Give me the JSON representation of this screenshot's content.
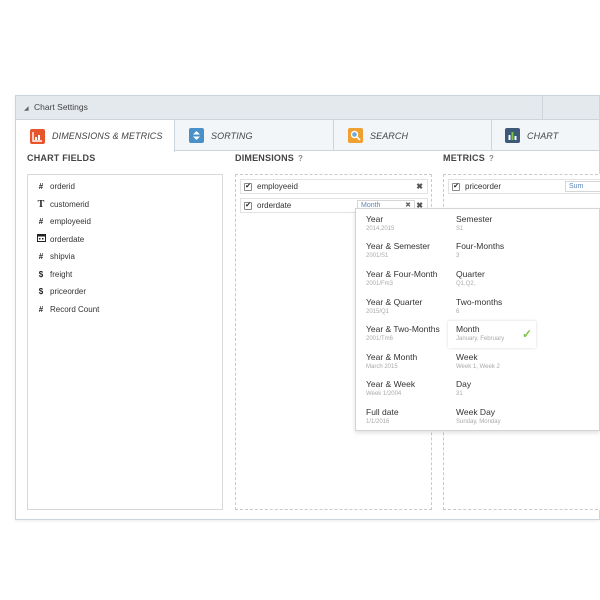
{
  "header": {
    "title": "Chart Settings"
  },
  "tabs": [
    {
      "label": "DIMENSIONS & METRICS",
      "icon": "dimensions-metrics-icon",
      "color": "#e8542c"
    },
    {
      "label": "SORTING",
      "icon": "sort-icon",
      "color": "#4a90c8"
    },
    {
      "label": "SEARCH",
      "icon": "search-icon",
      "color": "#f0a030"
    },
    {
      "label": "CHART",
      "icon": "bar-chart-icon",
      "color": "#3c5a78"
    }
  ],
  "chart_fields": {
    "title": "CHART FIELDS",
    "items": [
      {
        "icon": "#",
        "label": "orderid"
      },
      {
        "icon": "T",
        "label": "customerid"
      },
      {
        "icon": "#",
        "label": "employeeid"
      },
      {
        "icon": "cal",
        "label": "orderdate"
      },
      {
        "icon": "#",
        "label": "shipvia"
      },
      {
        "icon": "$",
        "label": "freight"
      },
      {
        "icon": "$",
        "label": "priceorder"
      },
      {
        "icon": "#",
        "label": "Record Count"
      }
    ]
  },
  "dimensions": {
    "title": "DIMENSIONS",
    "help": "?",
    "items": [
      {
        "label": "employeeid",
        "remove": "✖"
      },
      {
        "label": "orderdate",
        "select": "Month",
        "select_remove": "✖",
        "remove": "✖"
      }
    ]
  },
  "metrics": {
    "title": "METRICS",
    "help": "?",
    "items": [
      {
        "label": "priceorder",
        "select": "Sum"
      }
    ]
  },
  "date_dropdown": {
    "left": [
      {
        "label": "Year",
        "sample": "2014,2015"
      },
      {
        "label": "Year & Semester",
        "sample": "2001/S1"
      },
      {
        "label": "Year & Four-Month",
        "sample": "2001/Fm3"
      },
      {
        "label": "Year & Quarter",
        "sample": "2015/Q1"
      },
      {
        "label": "Year & Two-Months",
        "sample": "2001/Tm6"
      },
      {
        "label": "Year & Month",
        "sample": "March 2015"
      },
      {
        "label": "Year & Week",
        "sample": "Week 1/2004"
      },
      {
        "label": "Full date",
        "sample": "1/1/2016"
      }
    ],
    "right": [
      {
        "label": "Semester",
        "sample": "S1"
      },
      {
        "label": "Four-Months",
        "sample": "3"
      },
      {
        "label": "Quarter",
        "sample": "Q1,Q2,"
      },
      {
        "label": "Two-months",
        "sample": "6"
      },
      {
        "label": "Month",
        "sample": "January, February",
        "selected": true
      },
      {
        "label": "Week",
        "sample": "Week 1, Week 2"
      },
      {
        "label": "Day",
        "sample": "31"
      },
      {
        "label": "Week Day",
        "sample": "Sunday, Monday"
      }
    ],
    "check_mark": "✓"
  }
}
